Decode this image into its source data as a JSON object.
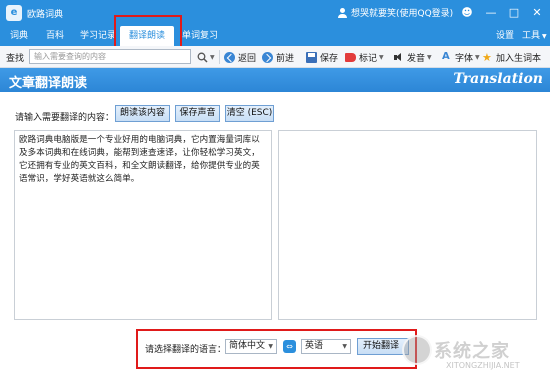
{
  "app": {
    "title": "欧路词典",
    "logo_glyph": "e"
  },
  "user": {
    "label": "想哭就要笑(使用QQ登录)"
  },
  "window_controls": {
    "skin": "☻",
    "minimize": "—",
    "maximize": "□",
    "close": "✕"
  },
  "menu": {
    "tabs": [
      {
        "label": "词典"
      },
      {
        "label": "百科"
      },
      {
        "label": "学习记录"
      },
      {
        "label": "翻译朗读",
        "active": true
      },
      {
        "label": "单词复习"
      }
    ],
    "settings_label": "设置",
    "tools_label": "工具"
  },
  "toolbar": {
    "search_label": "查找",
    "search_placeholder": "输入需要查询的内容",
    "search_icon": "magnifier-icon",
    "back_label": "返回",
    "forward_label": "前进",
    "save_label": "保存",
    "mark_label": "标记",
    "pronounce_label": "发音",
    "font_label": "字体",
    "add_wordbook_label": "加入生词本"
  },
  "banner": {
    "title": "文章翻译朗读",
    "title_en": "Translation"
  },
  "input_section": {
    "prompt": "请输入需要翻译的内容：",
    "read_button": "朗读该内容",
    "save_sound_button": "保存声音",
    "clear_button": "清空 (ESC)",
    "text": "欧路词典电脑版是一个专业好用的电脑词典，它内置海量词库以及多本词典和在线词典，能帮到速查速译，让你轻松学习英文，它还拥有专业的英文百科，和全文朗读翻译，给你提供专业的英语常识，学好英语就这么简单。"
  },
  "translate_bar": {
    "label": "请选择翻译的语言：",
    "source_language": "简体中文",
    "target_language": "英语",
    "start_button": "开始翻译"
  },
  "watermark": {
    "text": "系统之家",
    "url": "XITONGZHIJIA.NET"
  },
  "colors": {
    "accent": "#2b8fdd",
    "highlight": "#e01a1a"
  }
}
